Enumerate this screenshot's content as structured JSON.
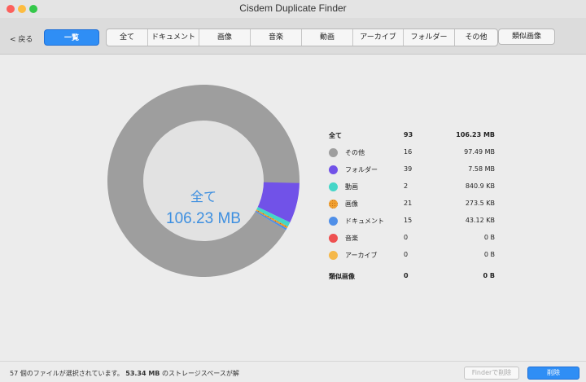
{
  "window": {
    "title": "Cisdem Duplicate Finder",
    "traffic_lights": [
      "#fc605c",
      "#fdbc40",
      "#34c84a"
    ]
  },
  "toolbar": {
    "back_label": "< 戻る",
    "overview_label": "一覧",
    "tabs": [
      "全て",
      "ドキュメント",
      "画像",
      "音楽",
      "動画",
      "アーカイブ",
      "フォルダー",
      "その他"
    ],
    "similar_images_label": "類似画像"
  },
  "summary": {
    "center_title": "全て",
    "center_size": "106.23 MB"
  },
  "legend": {
    "total": {
      "name": "全て",
      "count": "93",
      "size": "106.23 MB"
    },
    "items": [
      {
        "name": "その他",
        "count": "16",
        "size": "97.49 MB",
        "color": "#9e9e9e",
        "icon": "gray-circle"
      },
      {
        "name": "フォルダー",
        "count": "39",
        "size": "7.58 MB",
        "color": "#7152e8",
        "icon": "purple-circle"
      },
      {
        "name": "動画",
        "count": "2",
        "size": "840.9 KB",
        "color": "#45d6c8",
        "icon": "teal-circle"
      },
      {
        "name": "画像",
        "count": "21",
        "size": "273.5 KB",
        "color": "#f0a030",
        "icon": "orange-pattern-circle"
      },
      {
        "name": "ドキュメント",
        "count": "15",
        "size": "43.12 KB",
        "color": "#4f8fe8",
        "icon": "blue-circle"
      },
      {
        "name": "音楽",
        "count": "0",
        "size": "0 B",
        "color": "#ee5050",
        "icon": "red-circle"
      },
      {
        "name": "アーカイブ",
        "count": "0",
        "size": "0 B",
        "color": "#f5b84a",
        "icon": "yellow-circle"
      }
    ],
    "similar": {
      "name": "類似画像",
      "count": "0",
      "size": "0 B"
    }
  },
  "chart_data": {
    "type": "pie",
    "donut": true,
    "categories": [
      "その他",
      "フォルダー",
      "動画",
      "画像",
      "ドキュメント",
      "音楽",
      "アーカイブ"
    ],
    "values_kb": [
      99829.8,
      7761.9,
      840.9,
      273.5,
      43.12,
      0,
      0
    ],
    "colors": [
      "#9e9e9e",
      "#7152e8",
      "#45d6c8",
      "#f0a030",
      "#4f8fe8",
      "#ee5050",
      "#f5b84a"
    ]
  },
  "status": {
    "count": "57",
    "text_before_size": " 個のファイルが選択されています。",
    "size": "53.34 MB",
    "text_after_size": " のストレージスペースが解",
    "finder_delete_label": "Finderで削除",
    "delete_label": "削除"
  }
}
